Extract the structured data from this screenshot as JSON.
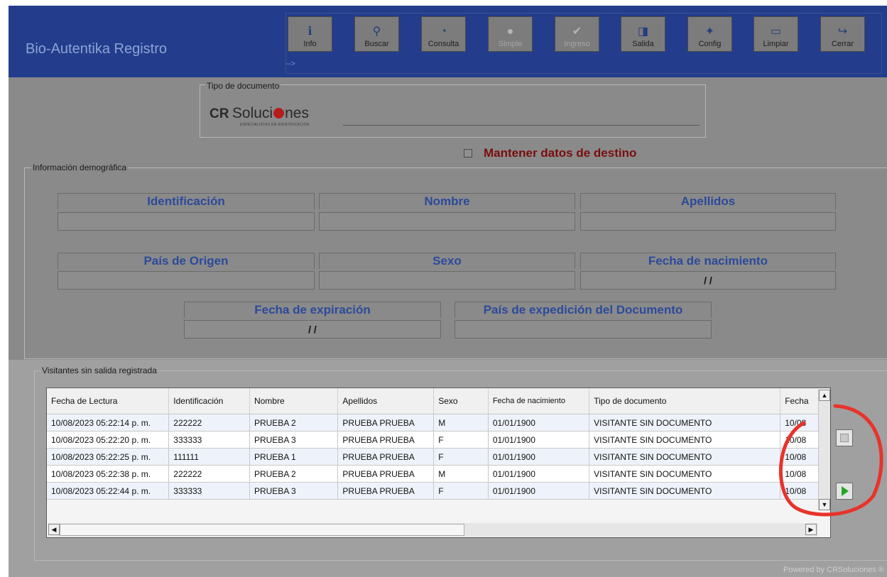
{
  "app": {
    "title": "Bio-Autentika Registro"
  },
  "toolbar": {
    "arrow": "-->",
    "buttons": [
      {
        "label": "Info",
        "icon": "info-icon",
        "glyph": "ℹ",
        "enabled": true
      },
      {
        "label": "Buscar",
        "icon": "search-icon",
        "glyph": "⚲",
        "enabled": true
      },
      {
        "label": "Consulta",
        "icon": "query-icon",
        "glyph": "◔",
        "enabled": true
      },
      {
        "label": "Simple",
        "icon": "simple-icon",
        "glyph": "●",
        "enabled": false
      },
      {
        "label": "Ingreso",
        "icon": "check-icon",
        "glyph": "✔",
        "enabled": false
      },
      {
        "label": "Salida",
        "icon": "exit-door-icon",
        "glyph": "◨",
        "enabled": true
      },
      {
        "label": "Config",
        "icon": "config-icon",
        "glyph": "✦",
        "enabled": true
      },
      {
        "label": "Limpiar",
        "icon": "clear-icon",
        "glyph": "▭",
        "enabled": true
      },
      {
        "label": "Cerrar",
        "icon": "close-arrow-icon",
        "glyph": "↪",
        "enabled": true
      }
    ]
  },
  "document_type": {
    "label": "Tipo de documento",
    "logo_cr": "CR",
    "logo_name_1": "Soluci",
    "logo_name_2": "nes",
    "logo_tagline": "ESPECIALISTAS EN IDENTIFICACIÓN"
  },
  "keep_destination": {
    "label": "Mantener datos de destino",
    "checked": false
  },
  "demographics": {
    "label": "Información demográfica",
    "fields": {
      "identificacion": {
        "label": "Identificación",
        "value": ""
      },
      "nombre": {
        "label": "Nombre",
        "value": ""
      },
      "apellidos": {
        "label": "Apellidos",
        "value": ""
      },
      "pais_origen": {
        "label": "País de Origen",
        "value": ""
      },
      "sexo": {
        "label": "Sexo",
        "value": ""
      },
      "fecha_nacimiento": {
        "label": "Fecha de nacimiento",
        "value": "/ /"
      },
      "fecha_expiracion": {
        "label": "Fecha de expiración",
        "value": "/ /"
      },
      "pais_expedicion": {
        "label": "País de expedición del Documento",
        "value": ""
      }
    }
  },
  "visitors": {
    "label": "Visitantes sin salida registrada",
    "columns": [
      "Fecha de Lectura",
      "Identificación",
      "Nombre",
      "Apellidos",
      "Sexo",
      "Fecha de nacimiento",
      "Tipo de documento",
      "Fecha"
    ],
    "rows": [
      [
        "10/08/2023 05:22:14 p. m.",
        "222222",
        "PRUEBA 2",
        "PRUEBA PRUEBA",
        "M",
        "01/01/1900",
        "VISITANTE SIN DOCUMENTO",
        "10/08"
      ],
      [
        "10/08/2023 05:22:20 p. m.",
        "333333",
        "PRUEBA 3",
        "PRUEBA PRUEBA",
        "F",
        "01/01/1900",
        "VISITANTE SIN DOCUMENTO",
        "10/08"
      ],
      [
        "10/08/2023 05:22:25 p. m.",
        "111111",
        "PRUEBA 1",
        "PRUEBA PRUEBA",
        "F",
        "01/01/1900",
        "VISITANTE SIN DOCUMENTO",
        "10/08"
      ],
      [
        "10/08/2023 05:22:38 p. m.",
        "222222",
        "PRUEBA 2",
        "PRUEBA PRUEBA",
        "M",
        "01/01/1900",
        "VISITANTE SIN DOCUMENTO",
        "10/08"
      ],
      [
        "10/08/2023 05:22:44 p. m.",
        "333333",
        "PRUEBA 3",
        "PRUEBA PRUEBA",
        "F",
        "01/01/1900",
        "VISITANTE SIN DOCUMENTO",
        "10/08"
      ]
    ]
  },
  "footer": {
    "powered": "Powered by CRSoluciones ®"
  },
  "colors": {
    "header": "#233d8c",
    "field_label": "#2c4a9a",
    "keep_label": "#7a0e0e"
  }
}
